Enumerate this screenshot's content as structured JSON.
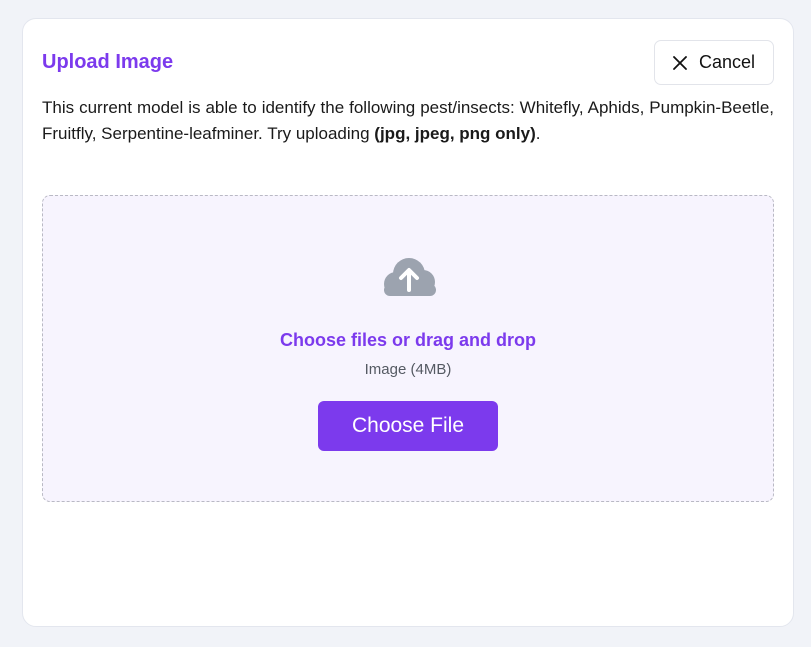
{
  "modal": {
    "title": "Upload Image",
    "cancel_label": "Cancel",
    "description_prefix": "This current model is able to identify the following pest/insects: Whitefly, Aphids, Pumpkin-Beetle, Fruitfly, Serpentine-leafminer. Try uploading ",
    "description_formats": "(jpg, jpeg, png only)",
    "description_suffix": "."
  },
  "dropzone": {
    "icon": "cloud-upload-icon",
    "prompt": "Choose files or drag and drop",
    "hint": "Image (4MB)",
    "button_label": "Choose File"
  },
  "colors": {
    "accent": "#7c3aed",
    "dropzone_bg": "#f7f4fe",
    "icon_gray": "#9ca3af"
  }
}
